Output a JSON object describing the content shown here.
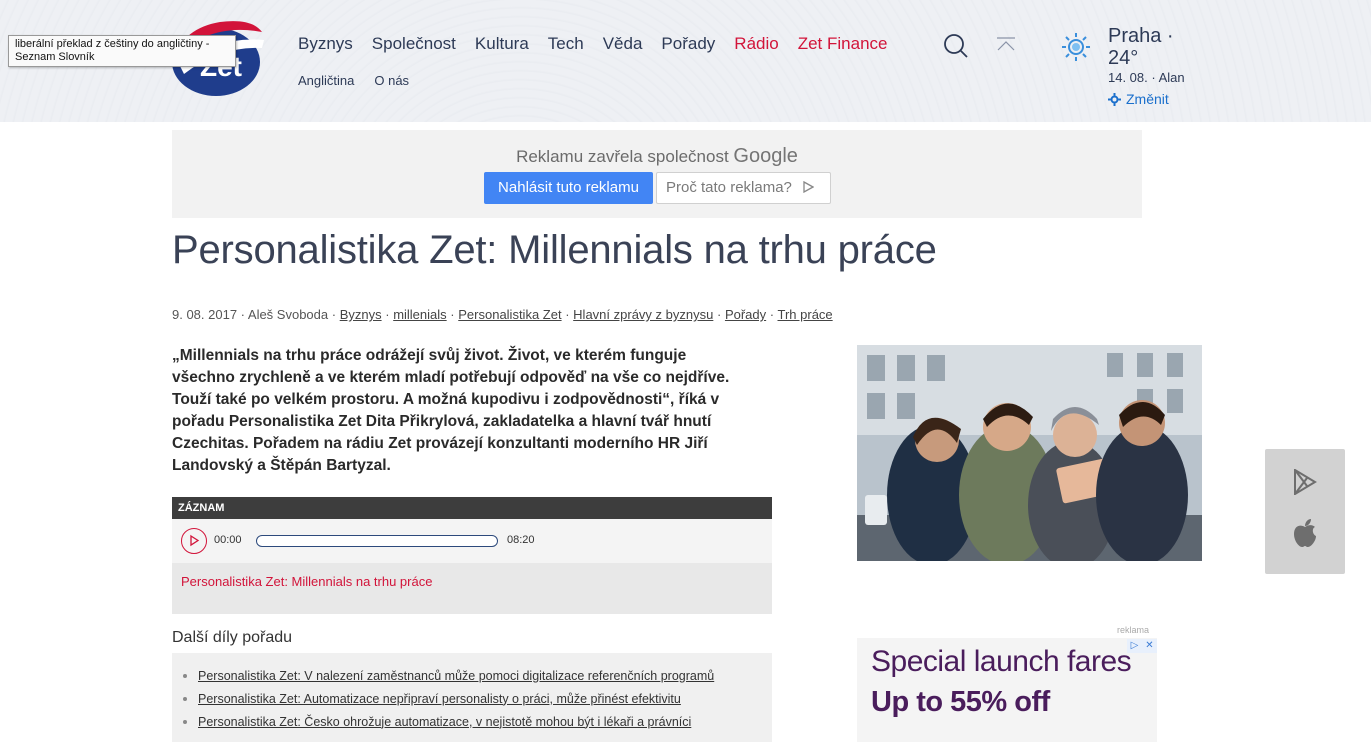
{
  "tooltip": {
    "line1": "liberální překlad z češtiny do angličtiny -",
    "line2": "Seznam Slovník"
  },
  "logo": {
    "text": "Zet"
  },
  "nav": {
    "main": [
      "Byznys",
      "Společnost",
      "Kultura",
      "Tech",
      "Věda",
      "Pořady"
    ],
    "radio": "Rádio",
    "finance": "Zet Finance",
    "sub": [
      "Angličtina",
      "O nás"
    ]
  },
  "weather": {
    "city": "Praha ·",
    "temp": "24°",
    "date": "14. 08. · Alan",
    "change": "Změnit"
  },
  "ad": {
    "closed_text": "Reklamu zavřela společnost",
    "google": "Google",
    "report_button": "Nahlásit tuto reklamu",
    "why_button": "Proč tato reklama?"
  },
  "article": {
    "title": "Personalistika Zet: Millennials na trhu práce",
    "meta": {
      "date_author": "9. 08. 2017 · Aleš Svoboda ·",
      "tags": [
        "Byznys",
        "millenials",
        "Personalistika Zet",
        "Hlavní zprávy z byznysu",
        "Pořady",
        "Trh práce"
      ],
      "separator": "·"
    },
    "lead": "„Millennials na trhu práce odrážejí svůj život. Život, ve kterém funguje všechno zrychleně a ve kterém mladí potřebují odpověď na vše co nejdříve. Touží také po velkém prostoru. A možná kupodivu i zodpovědnosti“, říká v pořadu Personalistika Zet Dita Přikrylová, zakladatelka a hlavní tvář hnutí Czechitas. Pořadem na rádiu Zet provázejí konzultanti moderního HR Jiří Landovský a Štěpán Bartyzal."
  },
  "player": {
    "label": "ZÁZNAM",
    "current": "00:00",
    "duration": "08:20",
    "progress": 0,
    "title": "Personalistika Zet: Millennials na trhu práce"
  },
  "more": {
    "heading": "Další díly pořadu",
    "items": [
      "Personalistika Zet: V nalezení zaměstnanců může pomoci digitalizace referenčních programů",
      "Personalistika Zet: Automatizace nepřipraví personalisty o práci, může přinést efektivitu",
      "Personalistika Zet: Česko ohrožuje automatizace, v nejistotě mohou být i lékaři a právníci"
    ]
  },
  "sidebar_ad": {
    "label": "reklama",
    "line1": "Special launch fares",
    "line2": "Up to 55% off"
  },
  "colors": {
    "accent_red": "#d2143a",
    "nav_text": "#2d3a56",
    "google_blue": "#4285f4",
    "ad_purple": "#4a1d5c"
  }
}
